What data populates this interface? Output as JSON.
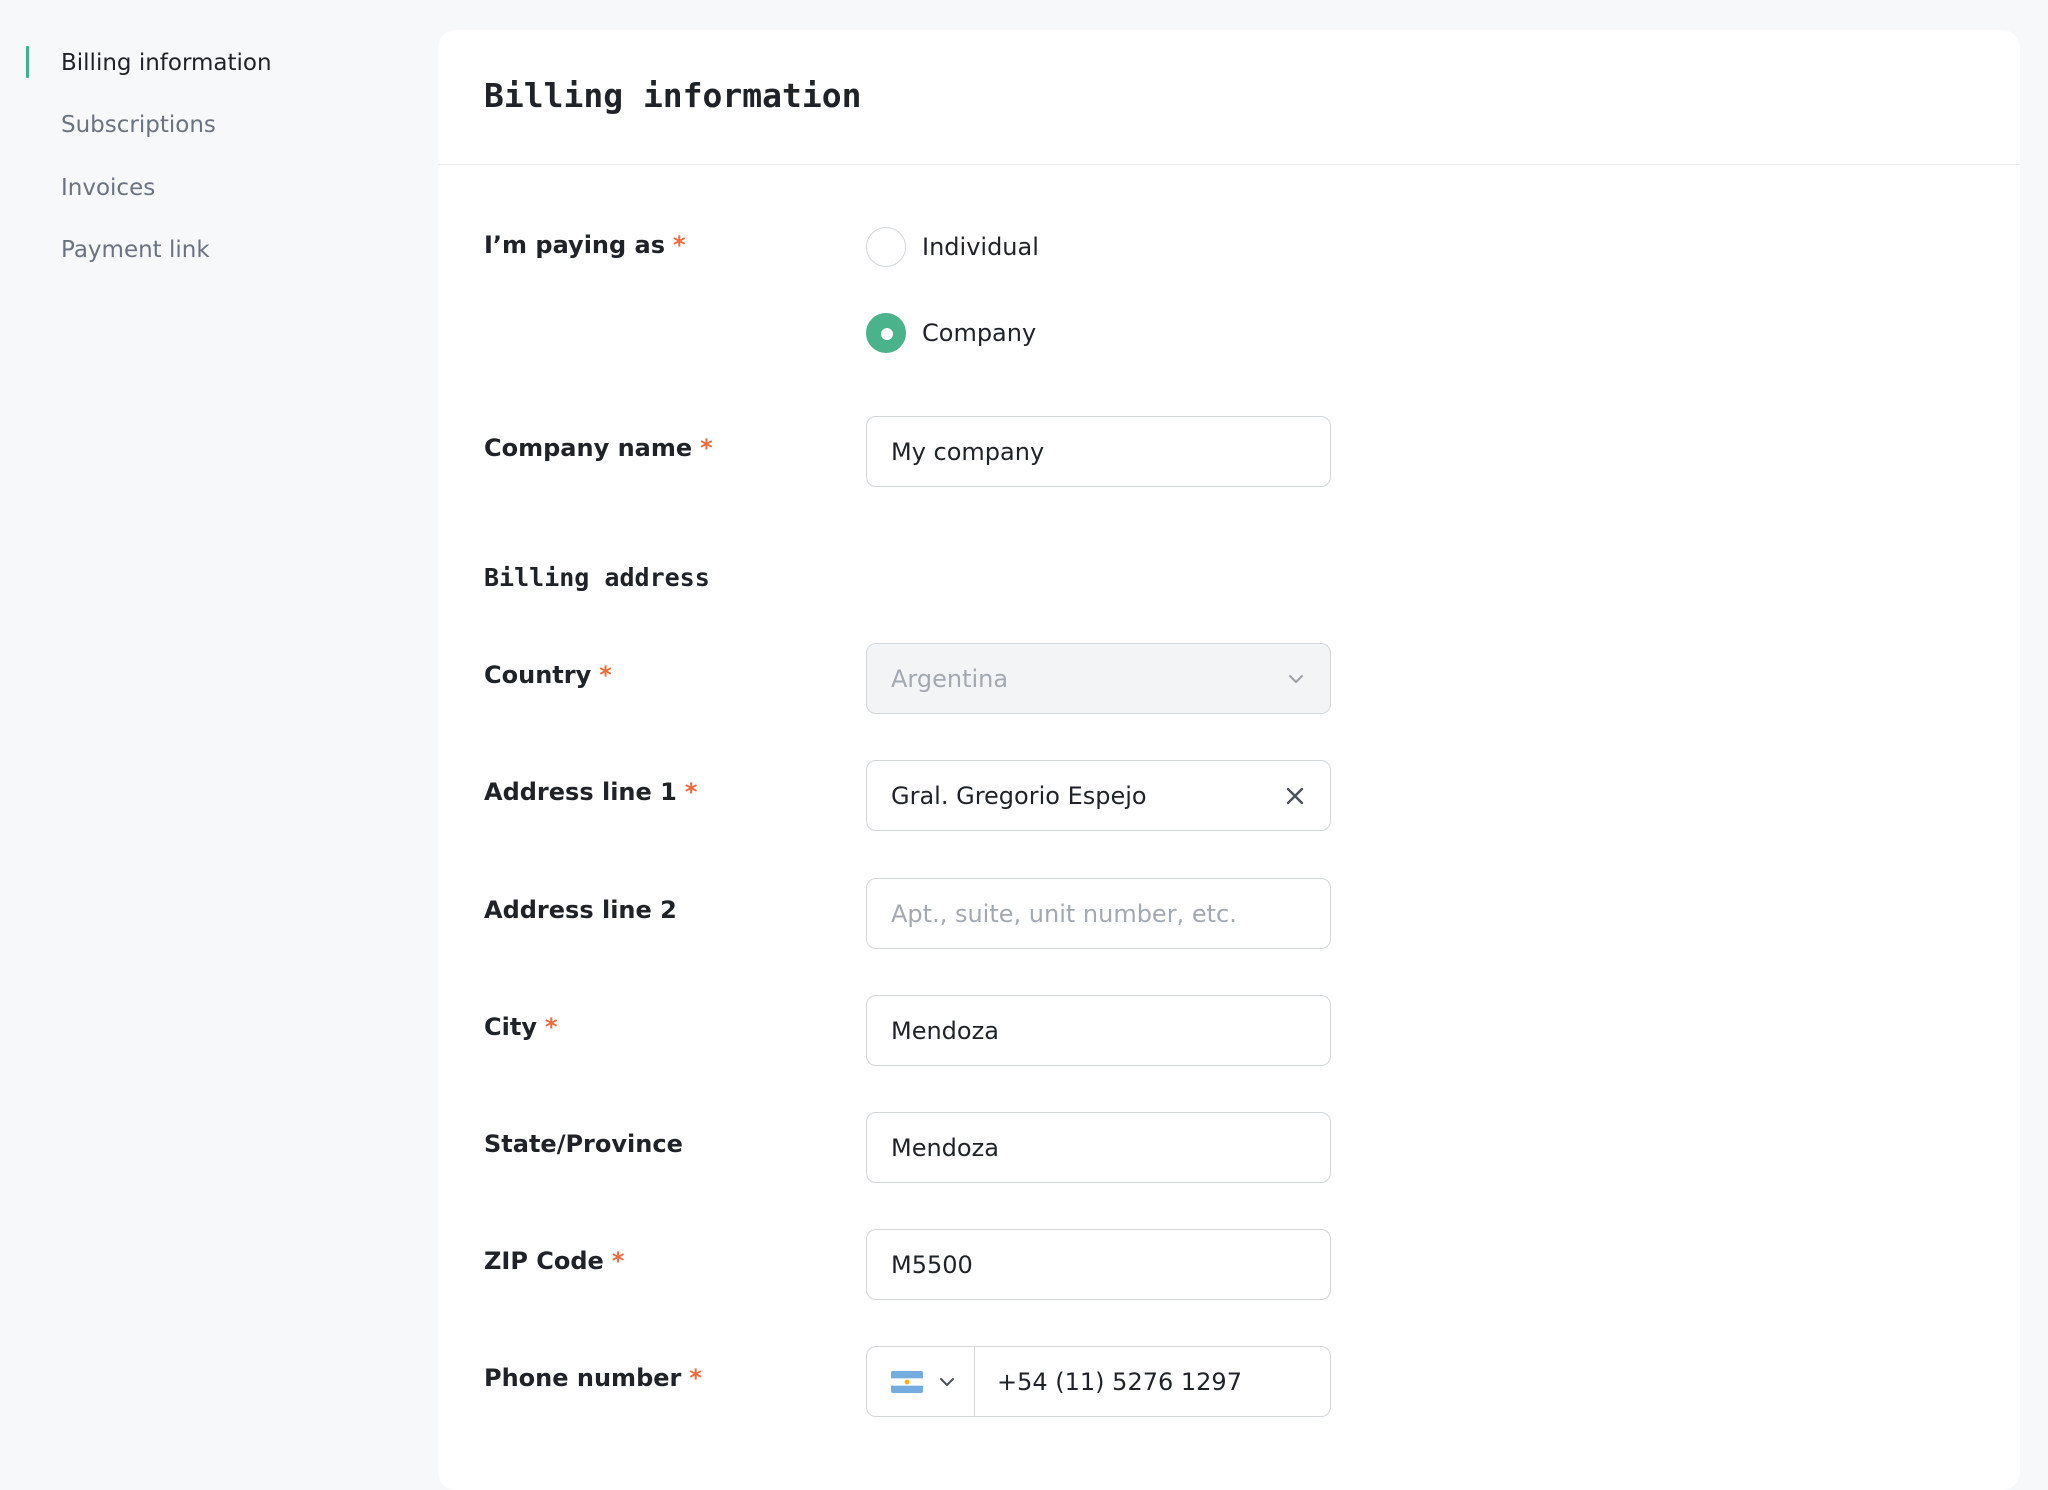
{
  "sidebar": {
    "items": [
      {
        "label": "Billing information",
        "active": true
      },
      {
        "label": "Subscriptions",
        "active": false
      },
      {
        "label": "Invoices",
        "active": false
      },
      {
        "label": "Payment link",
        "active": false
      }
    ]
  },
  "form": {
    "title": "Billing information",
    "required_mark": "*",
    "paying_as": {
      "label": "I’m paying as",
      "options": [
        {
          "label": "Individual",
          "selected": false
        },
        {
          "label": "Company",
          "selected": true
        }
      ]
    },
    "company_name": {
      "label": "Company name",
      "value": "My company"
    },
    "billing_address": {
      "title": "Billing address",
      "country": {
        "label": "Country",
        "value": "Argentina"
      },
      "address1": {
        "label": "Address line 1",
        "value": "Gral. Gregorio Espejo"
      },
      "address2": {
        "label": "Address line 2",
        "value": "",
        "placeholder": "Apt., suite, unit number, etc."
      },
      "city": {
        "label": "City",
        "value": "Mendoza"
      },
      "state": {
        "label": "State/Province",
        "value": "Mendoza"
      },
      "zip": {
        "label": "ZIP Code",
        "value": "M5500"
      },
      "phone": {
        "label": "Phone number",
        "value": "+54 (11) 5276 1297",
        "country_flag": "argentina-flag-icon"
      }
    }
  },
  "colors": {
    "accent": "#4bb38b",
    "required": "#f06a3a",
    "background": "#f7f8fa",
    "card": "#ffffff"
  }
}
